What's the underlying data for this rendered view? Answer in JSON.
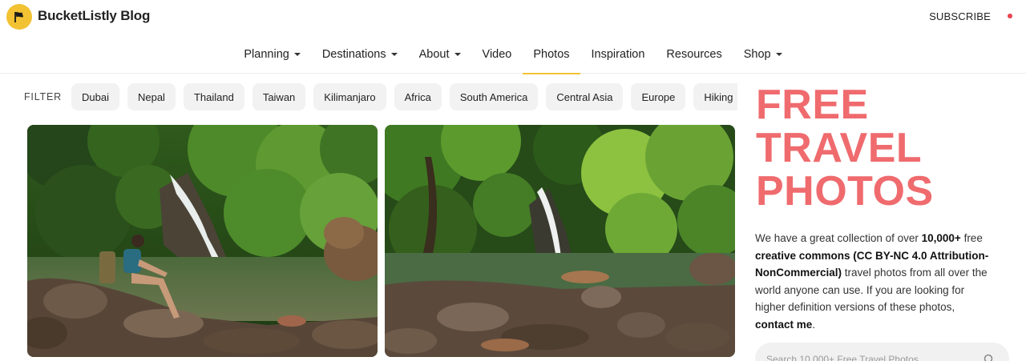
{
  "header": {
    "site_title": "BucketListly Blog",
    "subscribe_label": "SUBSCRIBE",
    "accent_color": "#f2c233",
    "dot_color": "#e8424c"
  },
  "nav": {
    "items": [
      {
        "label": "Planning",
        "dropdown": true,
        "active": false
      },
      {
        "label": "Destinations",
        "dropdown": true,
        "active": false
      },
      {
        "label": "About",
        "dropdown": true,
        "active": false
      },
      {
        "label": "Video",
        "dropdown": false,
        "active": false
      },
      {
        "label": "Photos",
        "dropdown": false,
        "active": true
      },
      {
        "label": "Inspiration",
        "dropdown": false,
        "active": false
      },
      {
        "label": "Resources",
        "dropdown": false,
        "active": false
      },
      {
        "label": "Shop",
        "dropdown": true,
        "active": false
      }
    ]
  },
  "filter": {
    "label": "FILTER",
    "chips": [
      "Dubai",
      "Nepal",
      "Thailand",
      "Taiwan",
      "Kilimanjaro",
      "Africa",
      "South America",
      "Central Asia",
      "Europe",
      "Hiking"
    ]
  },
  "photos": [
    {
      "subject": "waterfall-with-hiker"
    },
    {
      "subject": "waterfall-rocky-pool"
    }
  ],
  "sidebar": {
    "title_lines": [
      "FREE",
      "TRAVEL",
      "PHOTOS"
    ],
    "title_color": "#ef6b6e",
    "desc_1": "We have a great collection of over ",
    "desc_2": "10,000+",
    "desc_3": " free ",
    "desc_4": "creative commons (CC BY-NC 4.0 Attribution-NonCommercial)",
    "desc_5": " travel photos from all over the world anyone can use. If you are looking for higher definition versions of these photos, ",
    "desc_6": "contact me",
    "desc_7": "."
  },
  "search": {
    "placeholder": "Search 10,000+ Free Travel Photos"
  }
}
